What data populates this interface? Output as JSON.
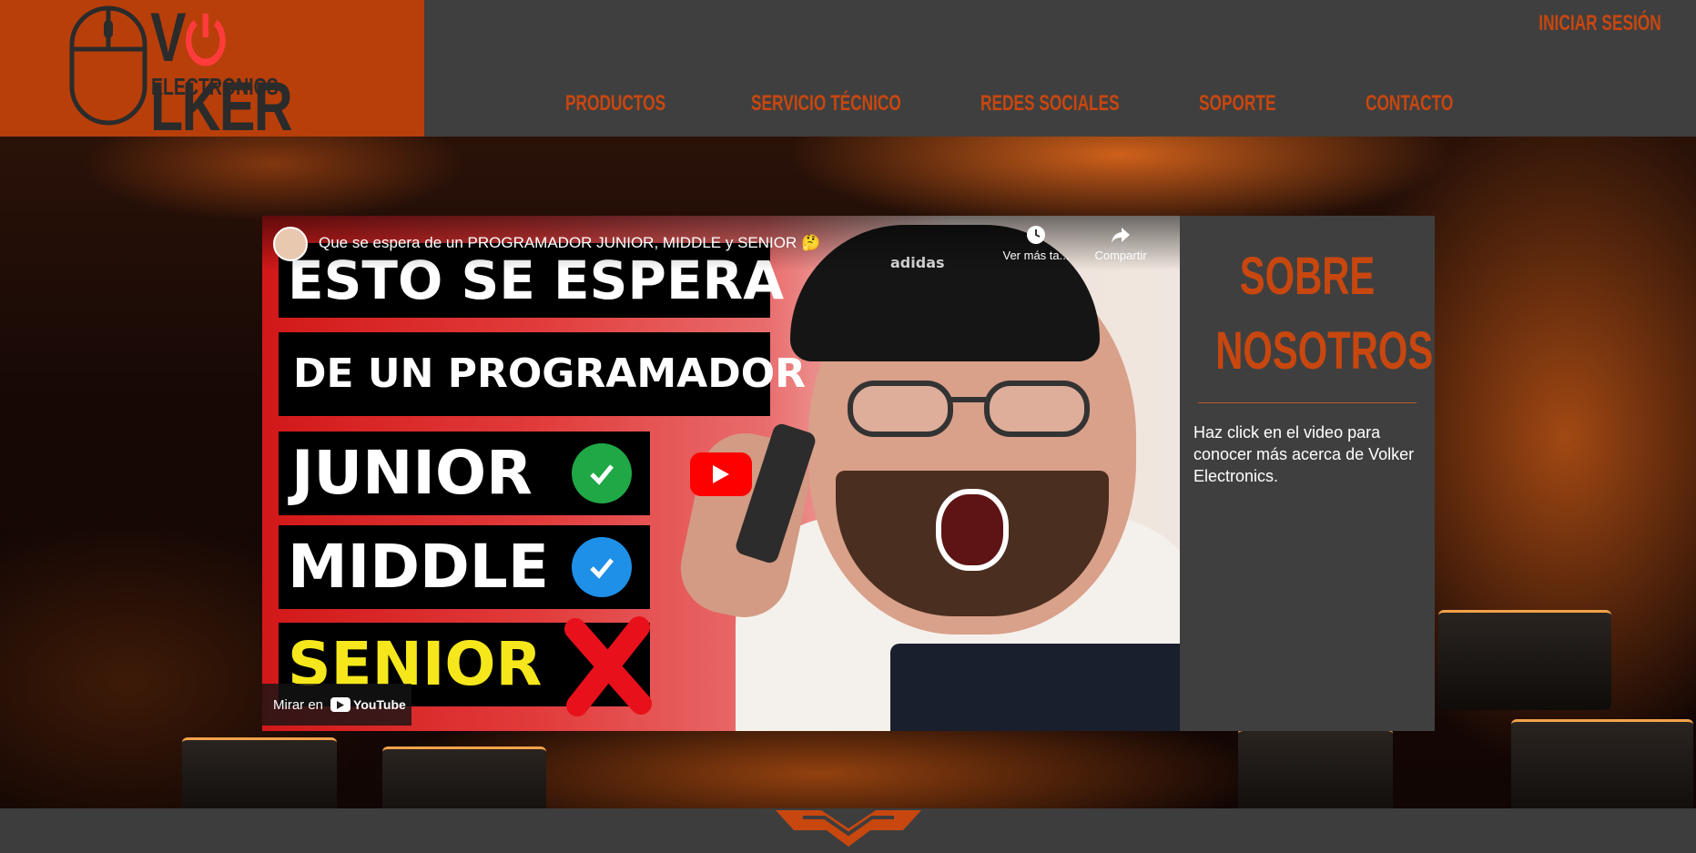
{
  "brand": {
    "name_prefix": "V",
    "name_suffix": "LKER",
    "subtitle": "ELECTRONICS",
    "accent_color": "#c8470f",
    "logo_bg_color": "#b83f0a",
    "power_icon_color": "#ff3b3b"
  },
  "header": {
    "login_label": "INICIAR SESIÓN",
    "nav": [
      {
        "label": "PRODUCTOS"
      },
      {
        "label": "SERVICIO TÉCNICO"
      },
      {
        "label": "REDES SOCIALES"
      },
      {
        "label": "SOPORTE"
      },
      {
        "label": "CONTACTO"
      }
    ]
  },
  "video": {
    "title": "Que se espera de un PROGRAMADOR JUNIOR, MIDDLE y SENIOR 🤔",
    "watch_later_label": "Ver más ta...",
    "share_label": "Compartir",
    "watch_on_label": "Mirar en",
    "youtube_label": "YouTube",
    "thumbnail_lines": {
      "line1": "ESTO SE ESPERA",
      "line2": "DE UN PROGRAMADOR",
      "line3": "JUNIOR",
      "line4": "MIDDLE",
      "line5": "SENIOR",
      "cap_brand": "adidas"
    }
  },
  "about": {
    "title_line1": "SOBRE",
    "title_line2": "NOSOTROS",
    "text": "Haz click en el video para conocer más acerca de Volker Electronics."
  }
}
